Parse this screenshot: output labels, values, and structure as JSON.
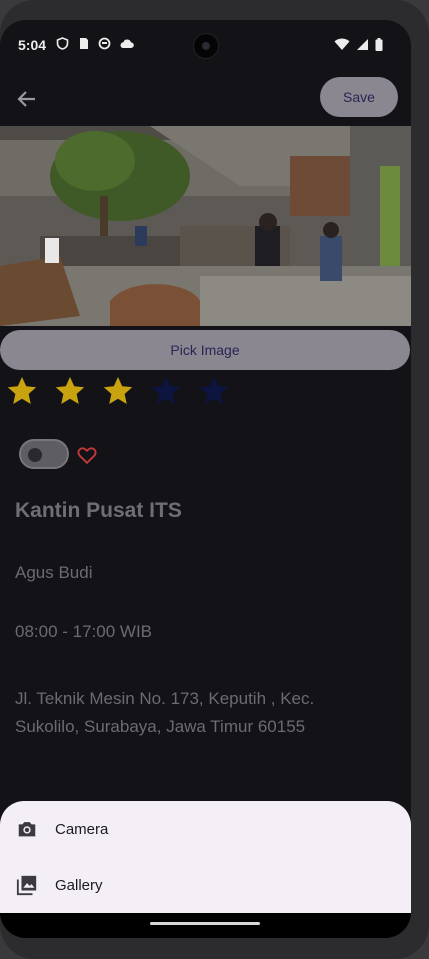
{
  "status_bar": {
    "time": "5:04"
  },
  "app_bar": {
    "save_label": "Save"
  },
  "form": {
    "pick_image_label": "Pick Image",
    "rating": 3,
    "rating_max": 5,
    "favorite_toggle_on": false,
    "name": "Kantin Pusat ITS",
    "owner": "Agus Budi",
    "hours": "08:00 - 17:00 WIB",
    "address_line1": "Jl. Teknik Mesin No. 173, Keputih , Kec.",
    "address_line2": "Sukolilo, Surabaya, Jawa Timur 60155"
  },
  "bottom_sheet": {
    "items": [
      {
        "label": "Camera",
        "icon": "camera-icon"
      },
      {
        "label": "Gallery",
        "icon": "gallery-icon"
      }
    ]
  },
  "colors": {
    "star_filled": "#c9a20f",
    "star_empty": "#0b1540",
    "heart": "#c03b3b",
    "sheet_bg": "#f4eef7"
  }
}
